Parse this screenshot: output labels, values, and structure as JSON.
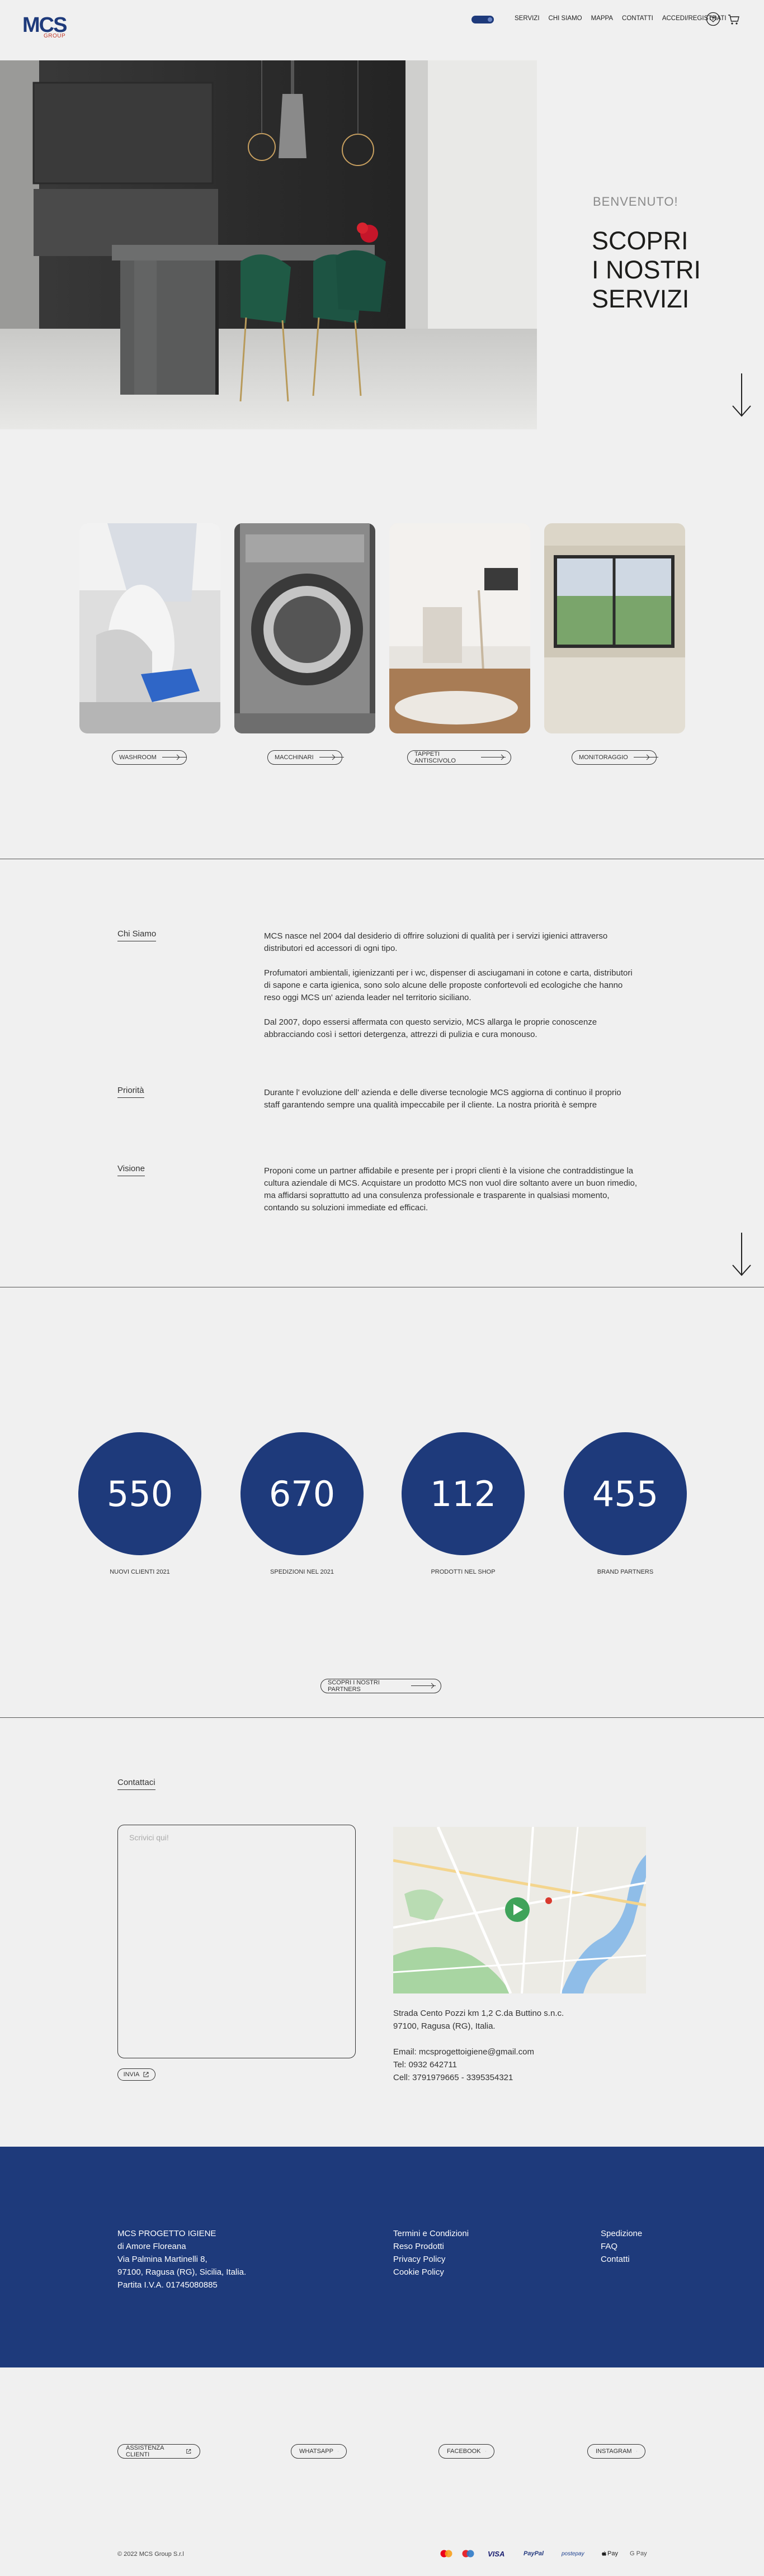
{
  "header": {
    "logo_text": "MCS",
    "logo_sub": "GROUP",
    "nav": [
      "SERVIZI",
      "CHI SIAMO",
      "MAPPA",
      "CONTATTI",
      "ACCEDI/REGISTRATI"
    ]
  },
  "hero": {
    "welcome": "BENVENUTO!",
    "title_line1": "SCOPRI",
    "title_line2": "I NOSTRI",
    "title_line3": "SERVIZI"
  },
  "services": [
    {
      "label": "WASHROOM"
    },
    {
      "label": "MACCHINARI"
    },
    {
      "label": "TAPPETI ANTISCIVOLO"
    },
    {
      "label": "MONITORAGGIO"
    }
  ],
  "about": {
    "chi_siamo_label": "Chi Siamo",
    "chi_siamo_p1": "MCS nasce nel 2004 dal desiderio di offrire soluzioni di qualità per i servizi igienici attraverso distributori ed accessori di ogni tipo.",
    "chi_siamo_p2": "Profumatori ambientali, igienizzanti per i wc, dispenser di asciugamani in cotone e carta, distributori di sapone e carta igienica, sono solo alcune delle proposte confortevoli ed ecologiche che hanno reso oggi MCS un' azienda leader nel territorio siciliano.",
    "chi_siamo_p3": "Dal 2007, dopo essersi affermata con questo servizio, MCS allarga le proprie conoscenze abbracciando così i settori detergenza, attrezzi di pulizia e cura monouso.",
    "priorita_label": "Priorità",
    "priorita_p1": "Durante l' evoluzione dell' azienda e delle diverse tecnologie MCS aggiorna di continuo il proprio",
    "priorita_p2": "staff garantendo sempre una qualità impeccabile per il cliente. La nostra priorità è sempre",
    "visione_label": "Visione",
    "visione_p": "Proponi come un partner affidabile e presente per i propri clienti è la visione che contraddistingue la cultura aziendale di MCS. Acquistare un prodotto MCS non vuol dire soltanto avere un buon rimedio, ma affidarsi soprattutto ad una consulenza professionale e trasparente in qualsiasi momento, contando su soluzioni immediate ed efficaci."
  },
  "stats": [
    {
      "value": "550",
      "label": "NUOVI CLIENTI 2021"
    },
    {
      "value": "670",
      "label": "SPEDIZIONI NEL 2021"
    },
    {
      "value": "112",
      "label": "PRODOTTI NEL SHOP"
    },
    {
      "value": "455",
      "label": "BRAND PARTNERS"
    }
  ],
  "partners_button": "SCOPRI I NOSTRI PARTNERS",
  "contact": {
    "label": "Contattaci",
    "placeholder": "Scrivici qui!",
    "send": "INVIA",
    "addr1": "Strada Cento Pozzi km 1,2 C.da Buttino s.n.c.",
    "addr2": "97100, Ragusa (RG), Italia.",
    "email": "Email: mcsprogettoigiene@gmail.com",
    "tel": "Tel: 0932 642711",
    "cell": "Cell: 3791979665 - 3395354321"
  },
  "footer": {
    "col1": [
      "MCS PROGETTO IGIENE",
      "di Amore Floreana",
      "Via Palmina Martinelli 8,",
      "97100, Ragusa (RG), Sicilia, Italia.",
      "Partita I.V.A. 01745080885"
    ],
    "col2": [
      "Termini e Condizioni",
      "Reso Prodotti",
      "Privacy Policy",
      "Cookie Policy"
    ],
    "col3": [
      "Spedizione",
      "FAQ",
      "Contatti"
    ]
  },
  "social": [
    "ASSISTENZA CLIENTI",
    "WHATSAPP",
    "FACEBOOK",
    "INSTAGRAM"
  ],
  "copyright": "© 2022 MCS Group S.r.l",
  "payments": [
    "VISA",
    "PayPal",
    "postepay",
    "Pay",
    "G Pay"
  ],
  "colors": {
    "brand": "#1e3a7b",
    "accent": "#c0392b",
    "bg": "#f0f0f0"
  }
}
